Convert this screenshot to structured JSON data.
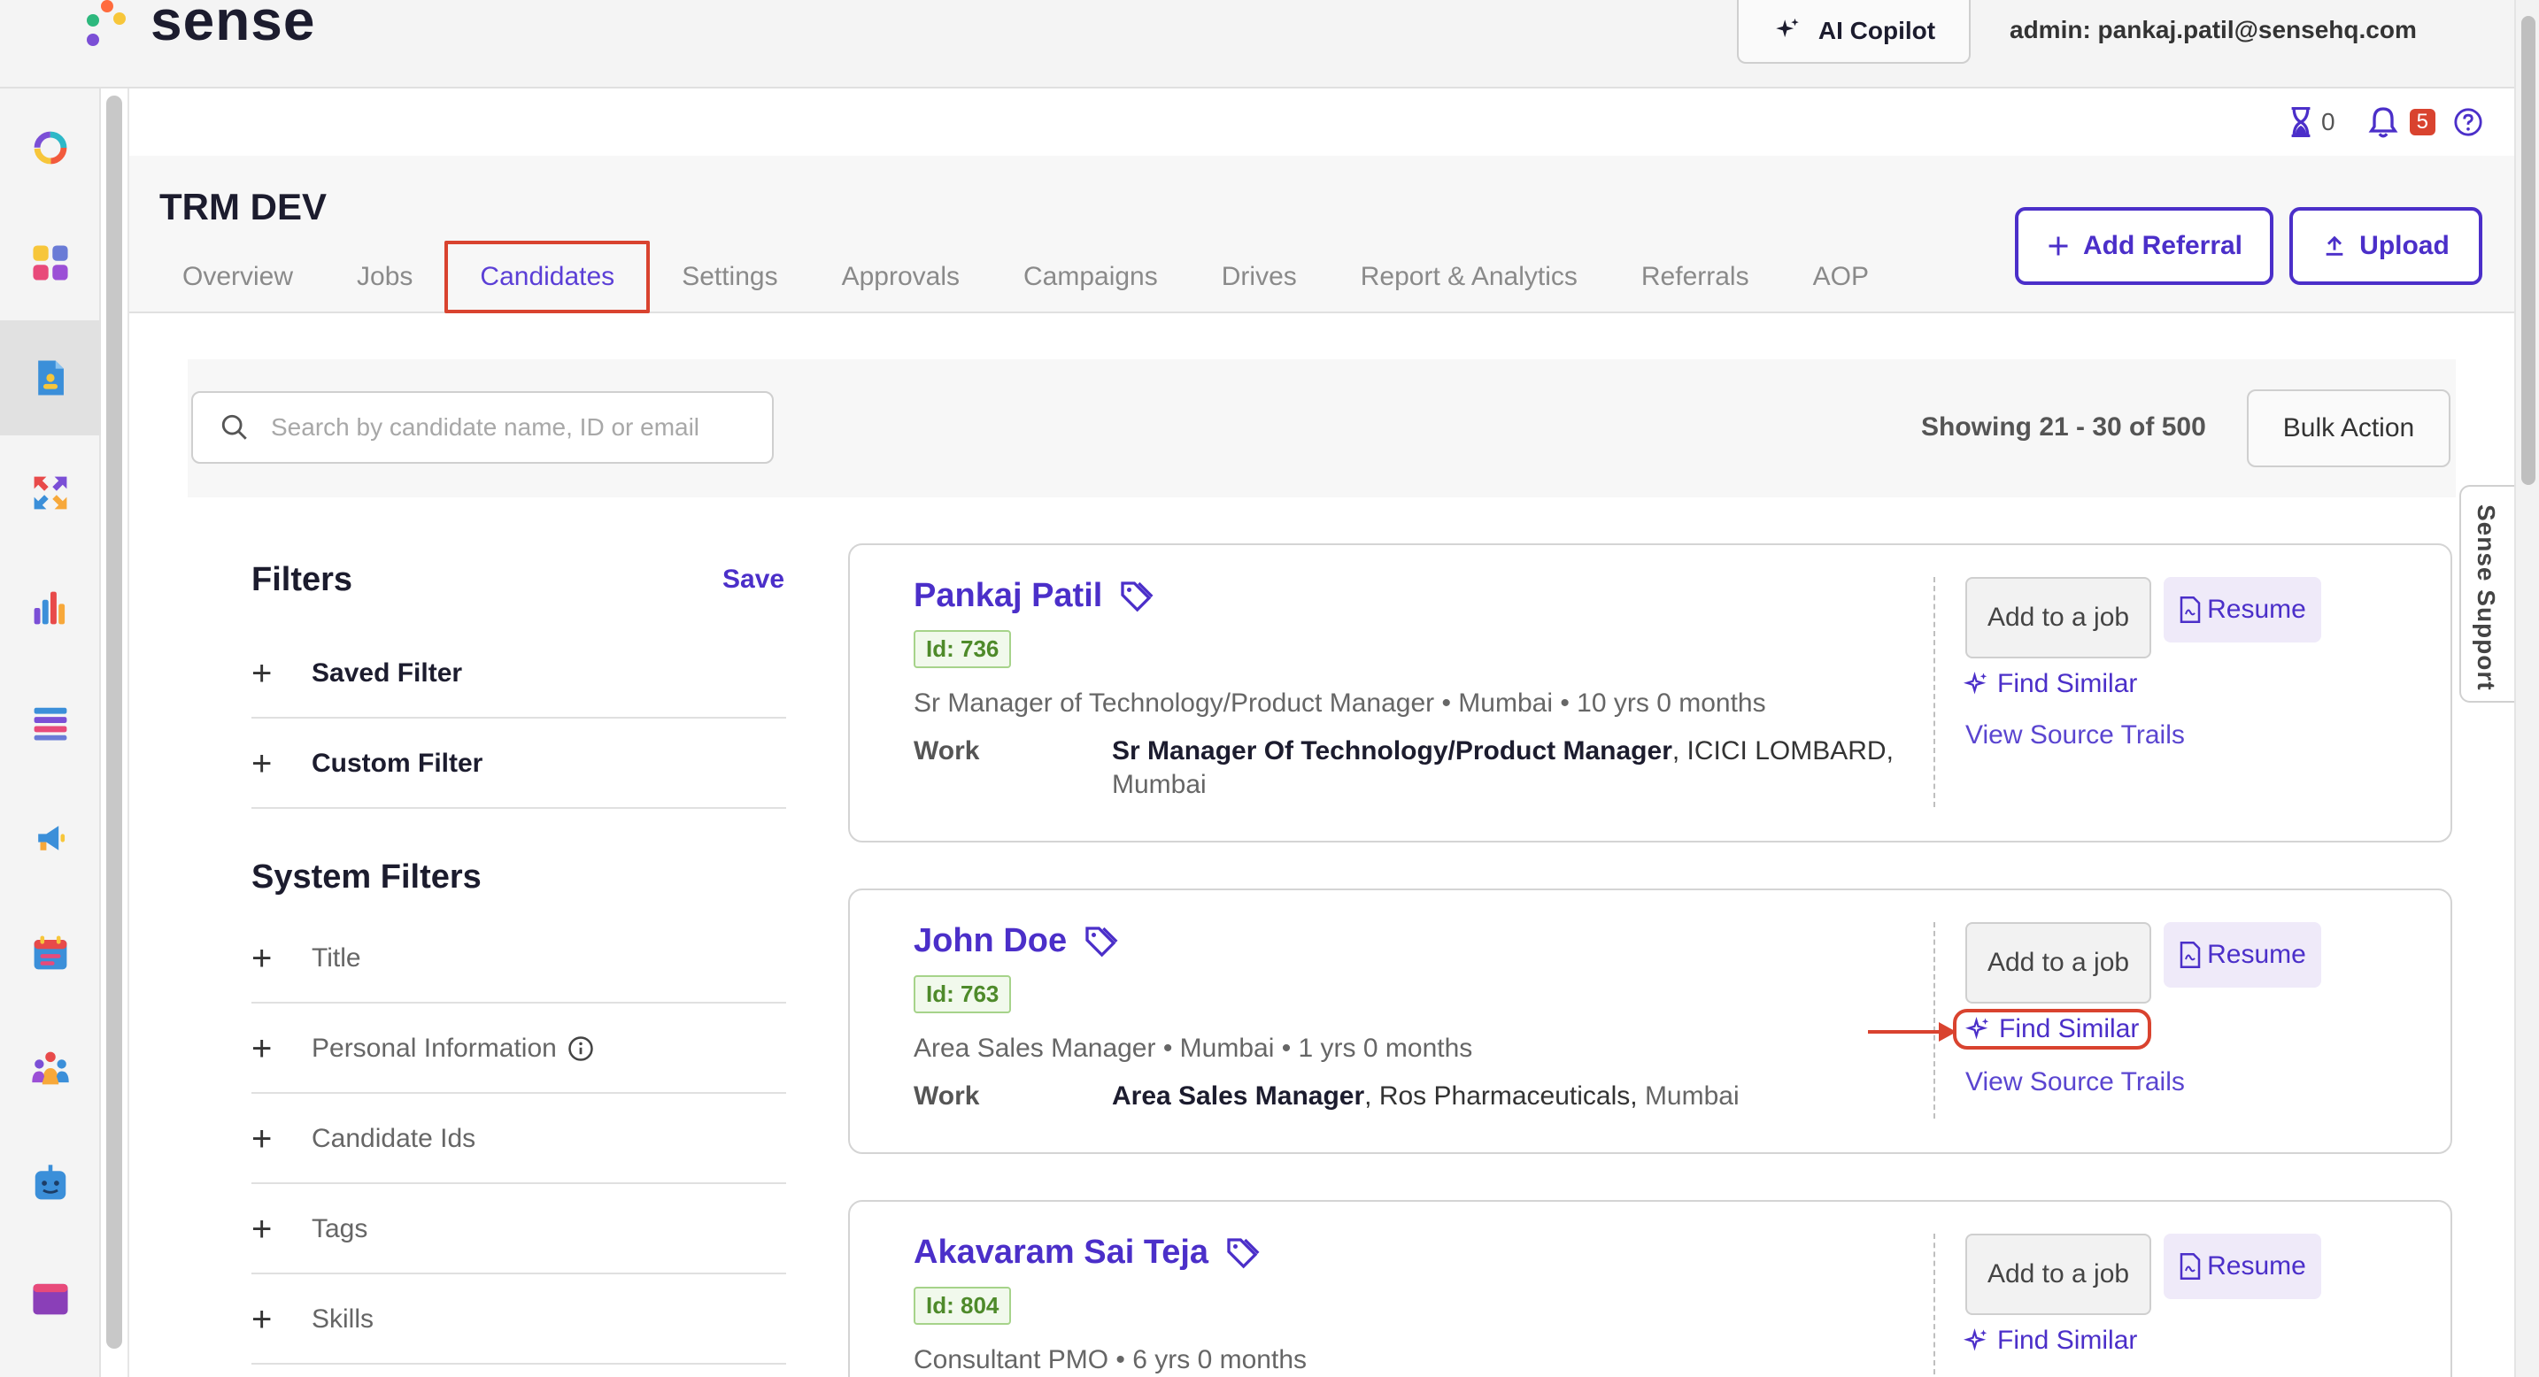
{
  "app": {
    "logo_text": "sense"
  },
  "topbar": {
    "copilot_label": "AI Copilot",
    "admin_text": "admin: pankaj.patil@sensehq.com"
  },
  "status": {
    "hourglass_count": "0",
    "notification_count": "5"
  },
  "nav": {
    "items": [
      {
        "name": "dashboard-ring",
        "active": false
      },
      {
        "name": "apps-grid",
        "active": false
      },
      {
        "name": "candidates-doc",
        "active": true
      },
      {
        "name": "referrals-arrows",
        "active": false
      },
      {
        "name": "analytics-bars",
        "active": false
      },
      {
        "name": "lists",
        "active": false
      },
      {
        "name": "campaigns-megaphone",
        "active": false
      },
      {
        "name": "calendar",
        "active": false
      },
      {
        "name": "teams",
        "active": false
      },
      {
        "name": "bot",
        "active": false
      },
      {
        "name": "browser-window",
        "active": false
      }
    ]
  },
  "header": {
    "title": "TRM DEV",
    "tabs": [
      {
        "label": "Overview",
        "active": false
      },
      {
        "label": "Jobs",
        "active": false
      },
      {
        "label": "Candidates",
        "active": true
      },
      {
        "label": "Settings",
        "active": false
      },
      {
        "label": "Approvals",
        "active": false
      },
      {
        "label": "Campaigns",
        "active": false
      },
      {
        "label": "Drives",
        "active": false
      },
      {
        "label": "Report & Analytics",
        "active": false
      },
      {
        "label": "Referrals",
        "active": false
      },
      {
        "label": "AOP",
        "active": false
      }
    ],
    "add_referral_label": "Add Referral",
    "upload_label": "Upload"
  },
  "search": {
    "placeholder": "Search by candidate name, ID or email",
    "value": "",
    "showing_text": "Showing 21 - 30 of 500",
    "bulk_action_label": "Bulk Action"
  },
  "filters": {
    "title": "Filters",
    "save_label": "Save",
    "saved_filter": "Saved Filter",
    "custom_filter": "Custom Filter",
    "system_title": "System Filters",
    "system": [
      "Title",
      "Personal Information",
      "Candidate Ids",
      "Tags",
      "Skills"
    ]
  },
  "candidates": [
    {
      "name": "Pankaj Patil",
      "id": "Id: 736",
      "summary": "Sr Manager of Technology/Product Manager • Mumbai • 10 yrs 0 months",
      "work_label": "Work",
      "work_title": "Sr Manager Of Technology/Product Manager",
      "work_company": ", ICICI LOMBARD,",
      "work_location": "Mumbai",
      "add_job": "Add to a job",
      "resume": "Resume",
      "find_similar": "Find Similar",
      "source_trails": "View Source Trails"
    },
    {
      "name": "John Doe",
      "id": "Id: 763",
      "summary": "Area Sales Manager • Mumbai • 1 yrs 0 months",
      "work_label": "Work",
      "work_title": "Area Sales Manager",
      "work_company": ", Ros Pharmaceuticals,",
      "work_location": " Mumbai",
      "add_job": "Add to a job",
      "resume": "Resume",
      "find_similar": "Find Similar",
      "source_trails": "View Source Trails"
    },
    {
      "name": "Akavaram Sai Teja",
      "id": "Id: 804",
      "summary": "Consultant PMO • 6 yrs 0 months",
      "add_job": "Add to a job",
      "resume": "Resume",
      "find_similar": "Find Similar"
    }
  ],
  "support": {
    "label": "Sense Support"
  },
  "colors": {
    "brand": "#4b2fc9",
    "highlight": "#d9432f",
    "id_green": "#4e8a2a"
  }
}
